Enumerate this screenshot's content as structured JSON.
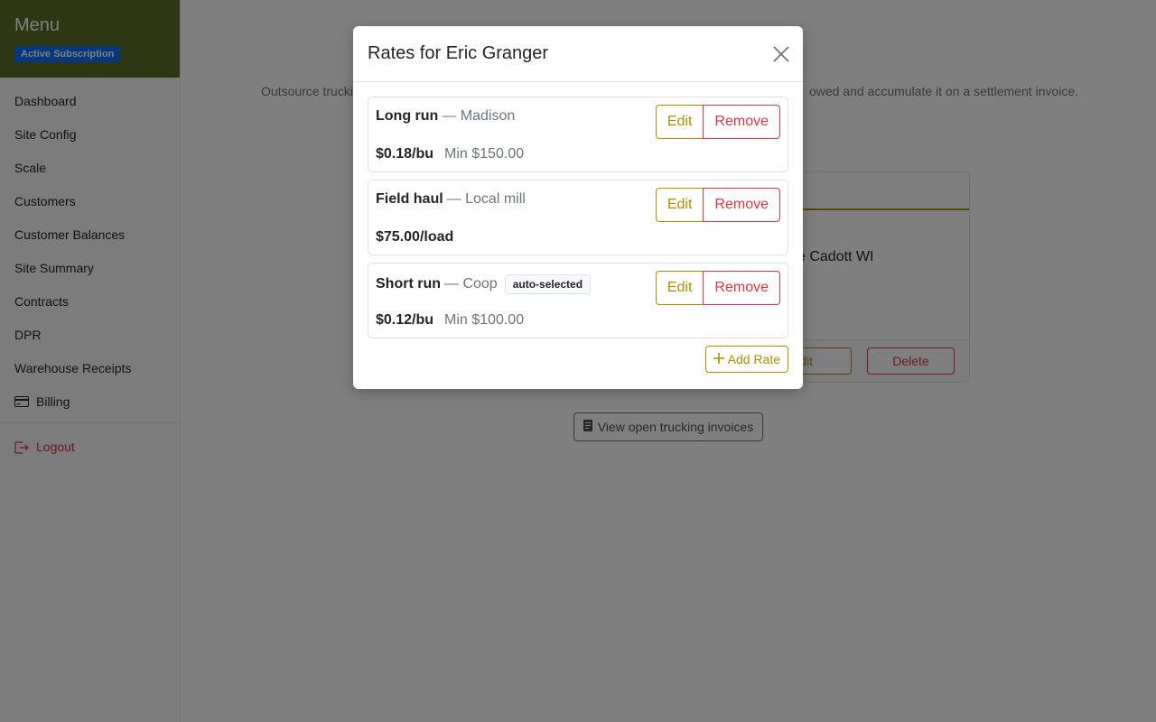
{
  "sidebar": {
    "title": "Menu",
    "subscription_badge": "Active Subscription",
    "items": [
      {
        "label": "Dashboard"
      },
      {
        "label": "Site Config"
      },
      {
        "label": "Scale"
      },
      {
        "label": "Customers"
      },
      {
        "label": "Customer Balances"
      },
      {
        "label": "Site Summary"
      },
      {
        "label": "Contracts"
      },
      {
        "label": "DPR"
      },
      {
        "label": "Warehouse Receipts"
      },
      {
        "label": "Billing",
        "icon": "credit-card-icon"
      }
    ],
    "logout": {
      "label": "Logout",
      "icon": "logout-icon"
    }
  },
  "main": {
    "description_left": "Outsource trucki",
    "description_right": "owed and accumulate it on a settlement invoice.",
    "card": {
      "body_text": "e Cadott WI",
      "edit_label": "Edit",
      "delete_label": "Delete"
    },
    "view_invoices": {
      "label": "View open trucking invoices",
      "icon": "document-icon"
    }
  },
  "modal": {
    "title": "Rates for Eric Granger",
    "close_icon": "close-icon",
    "rates": [
      {
        "name": "Long run",
        "destination": "— Madison",
        "amount": "$0.18/bu",
        "min": "Min $150.00",
        "badge": ""
      },
      {
        "name": "Field haul",
        "destination": "— Local mill",
        "amount": "$75.00/load",
        "min": "",
        "badge": ""
      },
      {
        "name": "Short run",
        "destination": "— Coop",
        "amount": "$0.12/bu",
        "min": "Min $100.00",
        "badge": "auto-selected"
      }
    ],
    "edit_label": "Edit",
    "remove_label": "Remove",
    "add_rate_label": "Add Rate",
    "add_rate_icon": "plus-icon"
  },
  "colors": {
    "sidebar_header": "#5a6e26",
    "badge_blue": "#0d6efd",
    "accent_gold": "#b08c00",
    "danger_red": "#dc3545"
  }
}
